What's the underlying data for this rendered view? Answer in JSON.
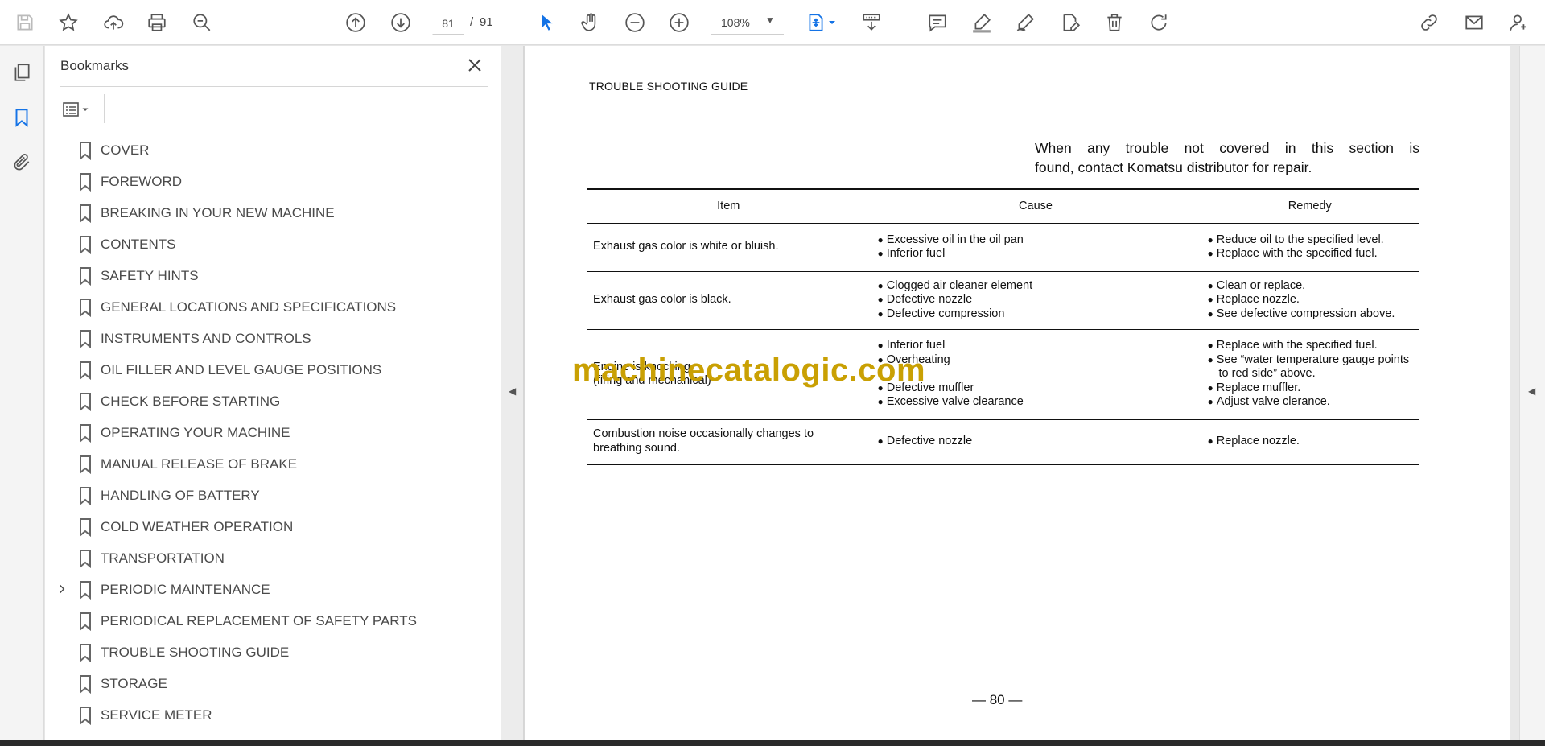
{
  "toolbar": {
    "page_current": "81",
    "page_separator": "/",
    "page_total": "91",
    "zoom": "108%"
  },
  "colors": {
    "accent": "#1473e6",
    "watermark": "#c9a003"
  },
  "bookmarks_panel": {
    "title": "Bookmarks",
    "items": [
      {
        "label": "COVER",
        "expandable": false
      },
      {
        "label": "FOREWORD",
        "expandable": false
      },
      {
        "label": "BREAKING IN YOUR NEW MACHINE",
        "expandable": false
      },
      {
        "label": "CONTENTS",
        "expandable": false
      },
      {
        "label": "SAFETY HINTS",
        "expandable": false
      },
      {
        "label": "GENERAL LOCATIONS AND SPECIFICATIONS",
        "expandable": false
      },
      {
        "label": "INSTRUMENTS AND CONTROLS",
        "expandable": false
      },
      {
        "label": "OIL FILLER AND LEVEL GAUGE POSITIONS",
        "expandable": false
      },
      {
        "label": "CHECK BEFORE STARTING",
        "expandable": false
      },
      {
        "label": "OPERATING YOUR MACHINE",
        "expandable": false
      },
      {
        "label": "MANUAL RELEASE OF BRAKE",
        "expandable": false
      },
      {
        "label": "HANDLING OF BATTERY",
        "expandable": false
      },
      {
        "label": "COLD WEATHER OPERATION",
        "expandable": false
      },
      {
        "label": "TRANSPORTATION",
        "expandable": false
      },
      {
        "label": "PERIODIC MAINTENANCE",
        "expandable": true
      },
      {
        "label": "PERIODICAL REPLACEMENT OF SAFETY PARTS",
        "expandable": false
      },
      {
        "label": "TROUBLE SHOOTING GUIDE",
        "expandable": false
      },
      {
        "label": "STORAGE",
        "expandable": false
      },
      {
        "label": "SERVICE METER",
        "expandable": false
      }
    ]
  },
  "document": {
    "heading": "TROUBLE SHOOTING GUIDE",
    "note_line1": "When any trouble not covered in this section is",
    "note_line2": "found, contact Komatsu distributor for repair.",
    "table": {
      "headers": [
        "Item",
        "Cause",
        "Remedy"
      ],
      "rows": [
        {
          "item": "Exhaust gas color is white or bluish.",
          "causes": [
            "Excessive oil in the oil pan",
            "Inferior fuel"
          ],
          "remedies": [
            "Reduce oil to the specified level.",
            "Replace with the specified fuel."
          ]
        },
        {
          "item": "Exhaust gas color is black.",
          "causes": [
            "Clogged air cleaner element",
            "Defective nozzle",
            "Defective compression"
          ],
          "remedies": [
            "Clean or replace.",
            "Replace nozzle.",
            "See defective compression above."
          ]
        },
        {
          "item": "Engine is knocking.\n(firing and mechanical)",
          "causes": [
            "Inferior fuel",
            "Overheating",
            "",
            "Defective muffler",
            "Excessive valve clearance"
          ],
          "remedies": [
            "Replace with the specified fuel.",
            "See “water temperature gauge points to red side” above.",
            "Replace muffler.",
            "Adjust valve clerance."
          ]
        },
        {
          "item": "Combustion noise occasionally changes to breathing sound.",
          "causes": [
            "Defective nozzle"
          ],
          "remedies": [
            "Replace nozzle."
          ]
        }
      ]
    },
    "watermark": "machinecatalogic.com",
    "page_number": "— 80 —"
  }
}
